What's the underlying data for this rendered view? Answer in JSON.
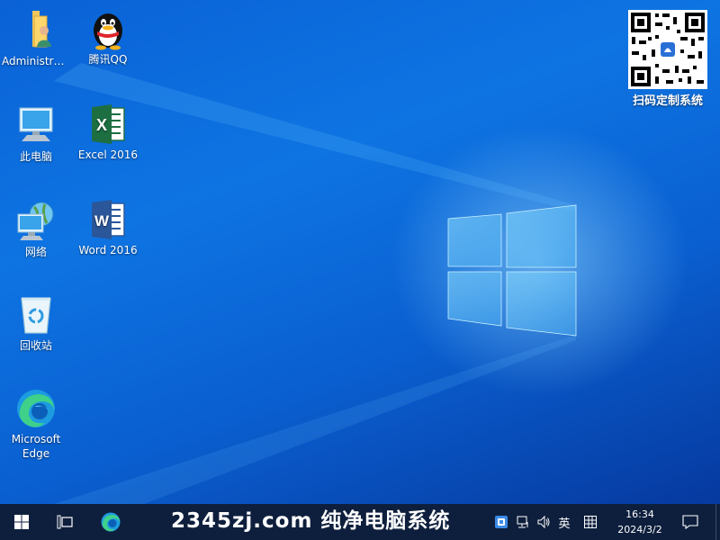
{
  "desktop": {
    "icons": [
      {
        "label": "Administra...",
        "icon": "user-folder-icon"
      },
      {
        "label": "腾讯QQ",
        "icon": "qq-penguin-icon"
      },
      {
        "label": "此电脑",
        "icon": "this-pc-icon"
      },
      {
        "label": "Excel 2016",
        "icon": "excel-icon"
      },
      {
        "label": "网络",
        "icon": "network-icon"
      },
      {
        "label": "Word 2016",
        "icon": "word-icon"
      },
      {
        "label": "回收站",
        "icon": "recycle-bin-icon"
      },
      {
        "label": "Microsoft Edge",
        "icon": "edge-icon"
      }
    ],
    "qr_caption": "扫码定制系统"
  },
  "taskbar": {
    "banner_text": "2345zj.com 纯净电脑系统",
    "ime_label": "英",
    "time": "16:34",
    "date": "2024/3/2"
  },
  "colors": {
    "taskbar_bg": "#0e1f3d",
    "excel_green": "#1d6f42",
    "word_blue": "#2b579a",
    "accent": "#0a62d6"
  }
}
